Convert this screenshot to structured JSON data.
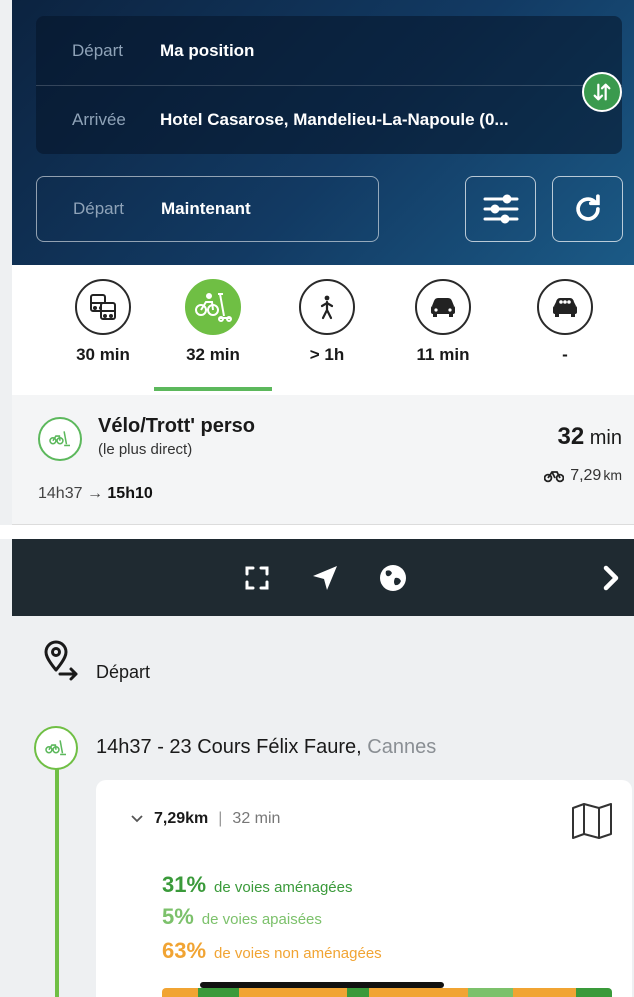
{
  "route": {
    "from_label": "Départ",
    "from_value": "Ma position",
    "to_label": "Arrivée",
    "to_value": "Hotel Casarose, Mandelieu-La-Napoule (0...",
    "swap_icon": "swap-vertical-icon"
  },
  "time": {
    "label": "Départ",
    "value": "Maintenant"
  },
  "modes": [
    {
      "name": "transit",
      "time": "30 min",
      "icon": "bus-train-icon"
    },
    {
      "name": "bike-scooter",
      "time": "32 min",
      "icon": "bike-scooter-icon",
      "active": true
    },
    {
      "name": "walk",
      "time": "> 1h",
      "icon": "walk-icon"
    },
    {
      "name": "car",
      "time": "11 min",
      "icon": "car-icon"
    },
    {
      "name": "carpool",
      "time": "-",
      "icon": "carpool-icon"
    }
  ],
  "summary": {
    "title": "Vélo/Trott' perso",
    "subtitle": "(le plus direct)",
    "depart_time": "14h37",
    "arrow": "→",
    "arrival_time": "15h10",
    "duration_value": "32",
    "duration_unit": "min",
    "distance": "7,29",
    "distance_unit": "km"
  },
  "toolbar": {
    "icons": [
      "fullscreen-icon",
      "locate-arrow-icon",
      "globe-icon",
      "chevron-right-icon"
    ]
  },
  "details": {
    "depart_label": "Départ",
    "step_time": "14h37",
    "step_address": "23 Cours Félix Faure,",
    "step_city": "Cannes",
    "card": {
      "distance": "7,29",
      "distance_unit": "km",
      "separator": "|",
      "duration": "32 min",
      "stats": [
        {
          "pct": "31%",
          "label": "de voies aménagées",
          "color": "#3a9a3a"
        },
        {
          "pct": "5%",
          "label": "de voies apaisées",
          "color": "#7cc16b"
        },
        {
          "pct": "63%",
          "label": "de voies non aménagées",
          "color": "#f1a433"
        }
      ],
      "bar_segments": [
        {
          "share": 0.08,
          "color": "#f1a433"
        },
        {
          "share": 0.09,
          "color": "#3a9a3a"
        },
        {
          "share": 0.24,
          "color": "#f1a433"
        },
        {
          "share": 0.05,
          "color": "#3a9a3a"
        },
        {
          "share": 0.22,
          "color": "#f1a433"
        },
        {
          "share": 0.1,
          "color": "#7cc16b"
        },
        {
          "share": 0.14,
          "color": "#f1a433"
        },
        {
          "share": 0.08,
          "color": "#3a9a3a"
        }
      ]
    }
  },
  "colors": {
    "accent": "#6fbf44",
    "header": "#0c2340",
    "toolbar": "#1f2a31"
  }
}
